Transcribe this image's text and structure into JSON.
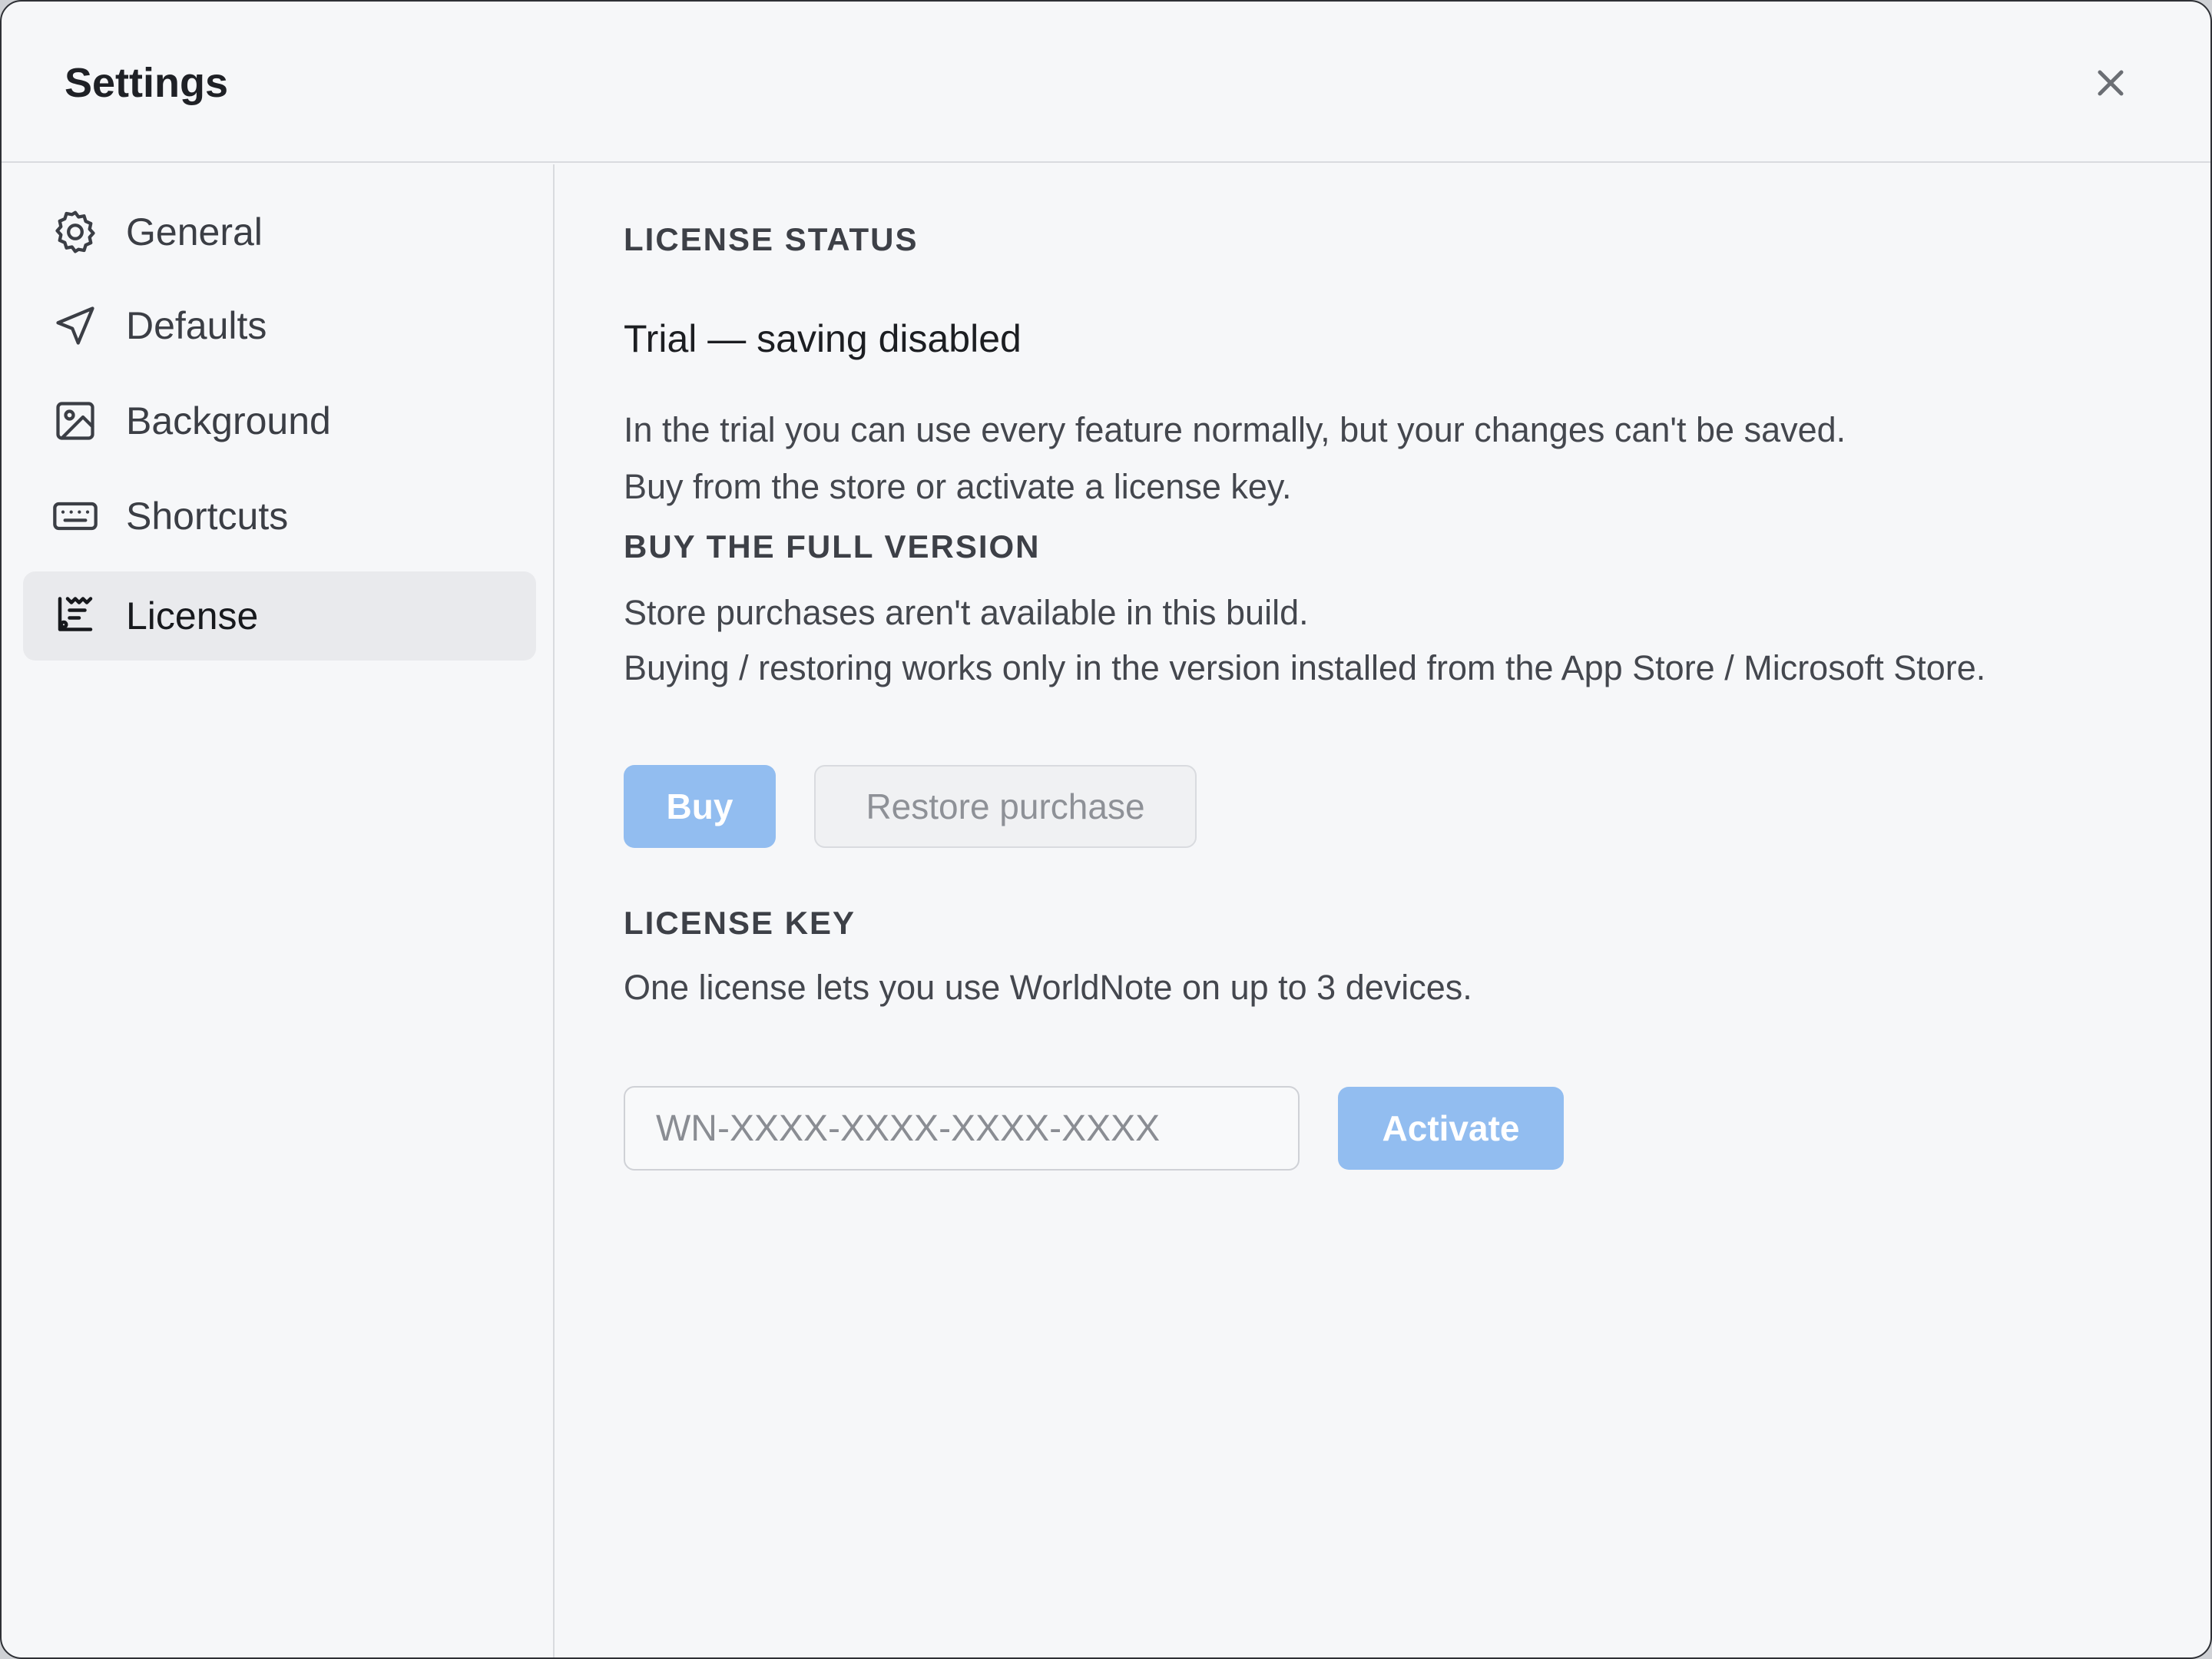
{
  "window": {
    "title": "Settings"
  },
  "sidebar": {
    "items": [
      {
        "label": "General",
        "icon": "gear-icon"
      },
      {
        "label": "Defaults",
        "icon": "navigation-arrow-icon"
      },
      {
        "label": "Background",
        "icon": "image-icon"
      },
      {
        "label": "Shortcuts",
        "icon": "keyboard-icon"
      },
      {
        "label": "License",
        "icon": "receipt-icon",
        "active": true
      }
    ]
  },
  "license": {
    "status_heading": "LICENSE STATUS",
    "status": "Trial — saving disabled",
    "status_desc_line1": "In the trial you can use every feature normally, but your changes can't be saved.",
    "status_desc_line2": "Buy from the store or activate a license key.",
    "buy_heading": "BUY THE FULL VERSION",
    "buy_desc_line1": "Store purchases aren't available in this build.",
    "buy_desc_line2": "Buying / restoring works only in the version installed from the App Store / Microsoft Store.",
    "buy_label": "Buy",
    "restore_label": "Restore purchase",
    "key_heading": "LICENSE KEY",
    "key_desc": "One license lets you use WorldNote on up to 3 devices.",
    "key_placeholder": "WN-XXXX-XXXX-XXXX-XXXX",
    "key_value": "",
    "activate_label": "Activate"
  },
  "colors": {
    "accent_disabled": "#92bdf0",
    "background": "#f6f7f9",
    "active_nav": "#e9eaed"
  }
}
